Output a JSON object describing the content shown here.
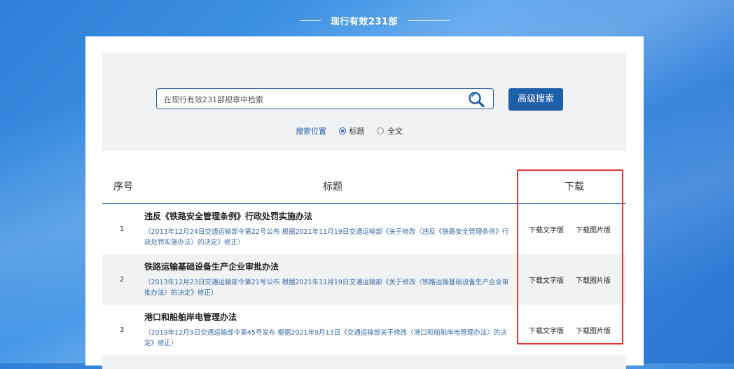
{
  "header": {
    "title": "现行有效231部"
  },
  "search": {
    "placeholder": "在现行有效231部规章中检索",
    "advanced_label": "高级搜索",
    "scope_label": "搜索位置",
    "options": [
      {
        "label": "标题",
        "selected": true
      },
      {
        "label": "全文",
        "selected": false
      }
    ]
  },
  "table": {
    "headers": {
      "num": "序号",
      "title": "标题",
      "download": "下载"
    },
    "rows": [
      {
        "num": "1",
        "title": "违反《铁路安全管理条例》行政处罚实施办法",
        "note": "（2013年12月24日交通运输部令第22号公布 根据2021年11月19日交通运输部《关于修改〈违反《铁路安全管理条例》行政处罚实施办法〉的决定》修正）",
        "dl_text": "下载文字版",
        "dl_image": "下载图片版"
      },
      {
        "num": "2",
        "title": "铁路运输基础设备生产企业审批办法",
        "note": "（2013年12月23日交通运输部令第21号公布 根据2021年11月19日交通运输部《关于修改〈铁路运输基础设备生产企业审批办法〉的决定》修正）",
        "dl_text": "下载文字版",
        "dl_image": "下载图片版"
      },
      {
        "num": "3",
        "title": "港口和船舶岸电管理办法",
        "note": "（2019年12月9日交通运输部令第45号发布 根据2021年9月13日《交通运输部关于修改〈港口和船舶岸电管理办法〉的决定》修正）",
        "dl_text": "下载文字版",
        "dl_image": "下载图片版"
      }
    ]
  },
  "colors": {
    "accent": "#1f5ea8",
    "highlight_box": "#e63535",
    "note_text": "#3a6aa6"
  }
}
